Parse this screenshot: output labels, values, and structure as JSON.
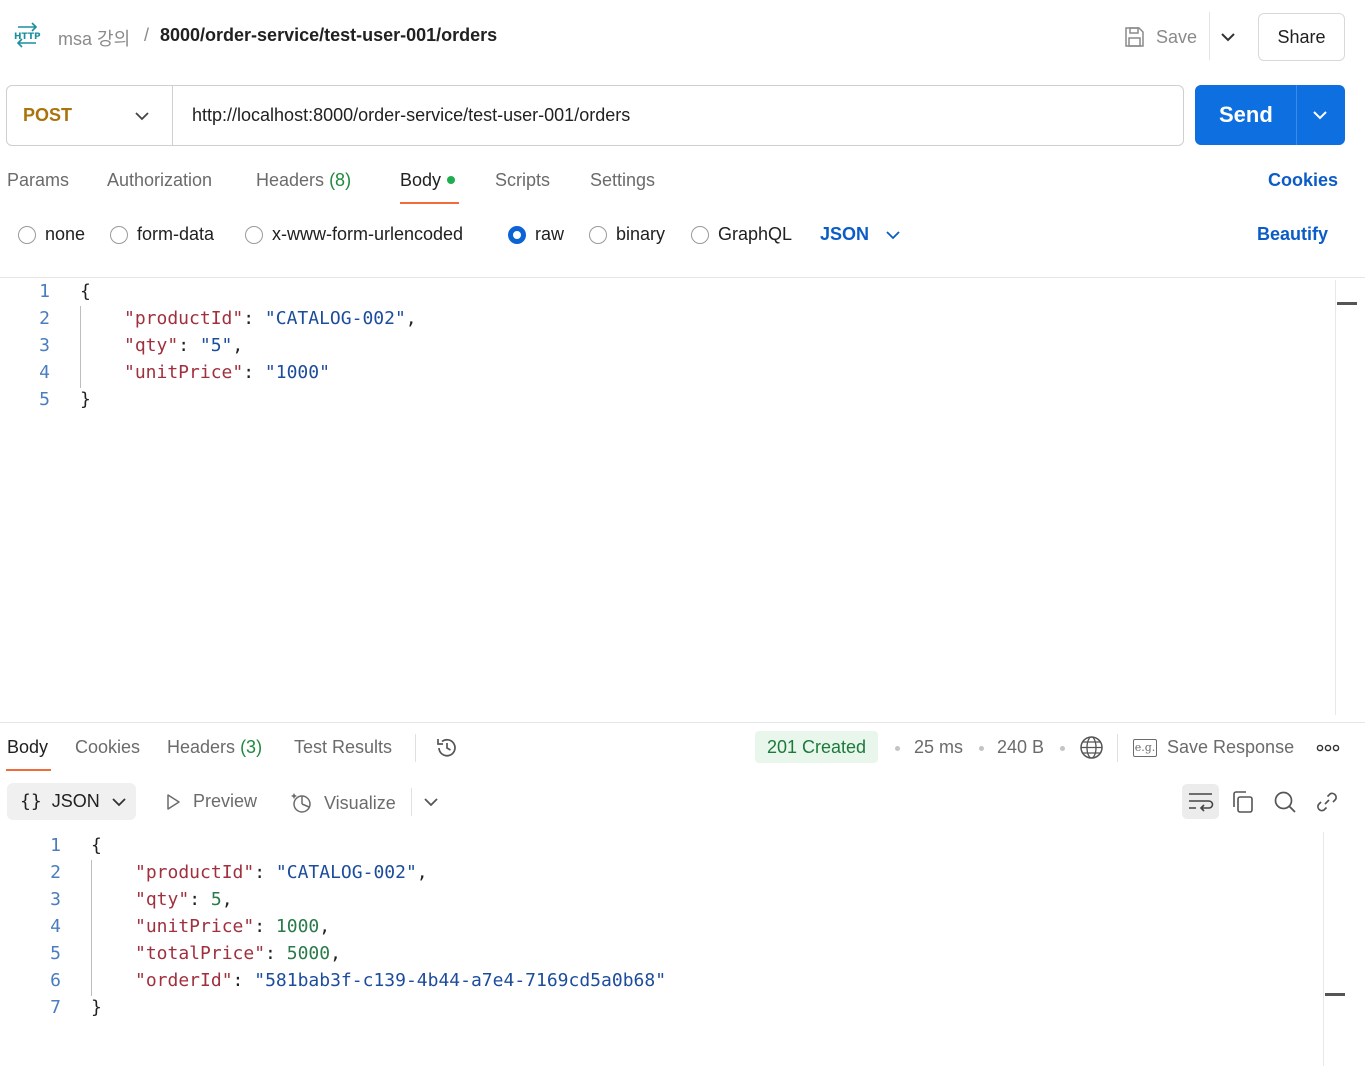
{
  "header": {
    "http_badge": "HTTP",
    "collection": "msa 강의",
    "separator": "/",
    "request_name": "8000/order-service/test-user-001/orders",
    "save_label": "Save",
    "share_label": "Share"
  },
  "request": {
    "method": "POST",
    "url": "http://localhost:8000/order-service/test-user-001/orders",
    "send_label": "Send"
  },
  "request_tabs": {
    "params": "Params",
    "authorization": "Authorization",
    "headers": "Headers",
    "headers_count": "(8)",
    "body": "Body",
    "scripts": "Scripts",
    "settings": "Settings",
    "cookies": "Cookies"
  },
  "body_modes": {
    "none": "none",
    "form_data": "form-data",
    "urlencoded": "x-www-form-urlencoded",
    "raw": "raw",
    "binary": "binary",
    "graphql": "GraphQL",
    "selected": "raw",
    "format": "JSON",
    "beautify": "Beautify"
  },
  "request_body": {
    "line_numbers": [
      "1",
      "2",
      "3",
      "4",
      "5"
    ],
    "open_brace": "{",
    "close_brace": "}",
    "k1": "\"productId\"",
    "v1": "\"CATALOG-002\"",
    "k2": "\"qty\"",
    "v2": "\"5\"",
    "k3": "\"unitPrice\"",
    "v3": "\"1000\""
  },
  "response_tabs": {
    "body": "Body",
    "cookies": "Cookies",
    "headers": "Headers",
    "headers_count": "(3)",
    "test_results": "Test Results"
  },
  "response_meta": {
    "status": "201 Created",
    "time": "25 ms",
    "size": "240 B",
    "save_response": "Save Response",
    "save_icon_text": "e.g."
  },
  "response_toolbar": {
    "braces": "{}",
    "format": "JSON",
    "preview": "Preview",
    "visualize": "Visualize"
  },
  "response_body": {
    "line_numbers": [
      "1",
      "2",
      "3",
      "4",
      "5",
      "6",
      "7"
    ],
    "open_brace": "{",
    "close_brace": "}",
    "k1": "\"productId\"",
    "v1": "\"CATALOG-002\"",
    "k2": "\"qty\"",
    "v2": "5",
    "k3": "\"unitPrice\"",
    "v3": "1000",
    "k4": "\"totalPrice\"",
    "v4": "5000",
    "k5": "\"orderId\"",
    "v5": "\"581bab3f-c139-4b44-a7e4-7169cd5a0b68\""
  },
  "colors": {
    "accent_blue": "#0d6fe0",
    "method_post": "#a9740b",
    "status_green": "#1d7a3a",
    "tab_underline": "#f26b3a"
  },
  "icons": [
    "http-icon",
    "save-icon",
    "chevron-down-icon",
    "history-icon",
    "globe-icon",
    "save-response-icon",
    "more-icon",
    "play-icon",
    "visualize-icon",
    "wrap-icon",
    "copy-icon",
    "search-icon",
    "link-icon"
  ]
}
